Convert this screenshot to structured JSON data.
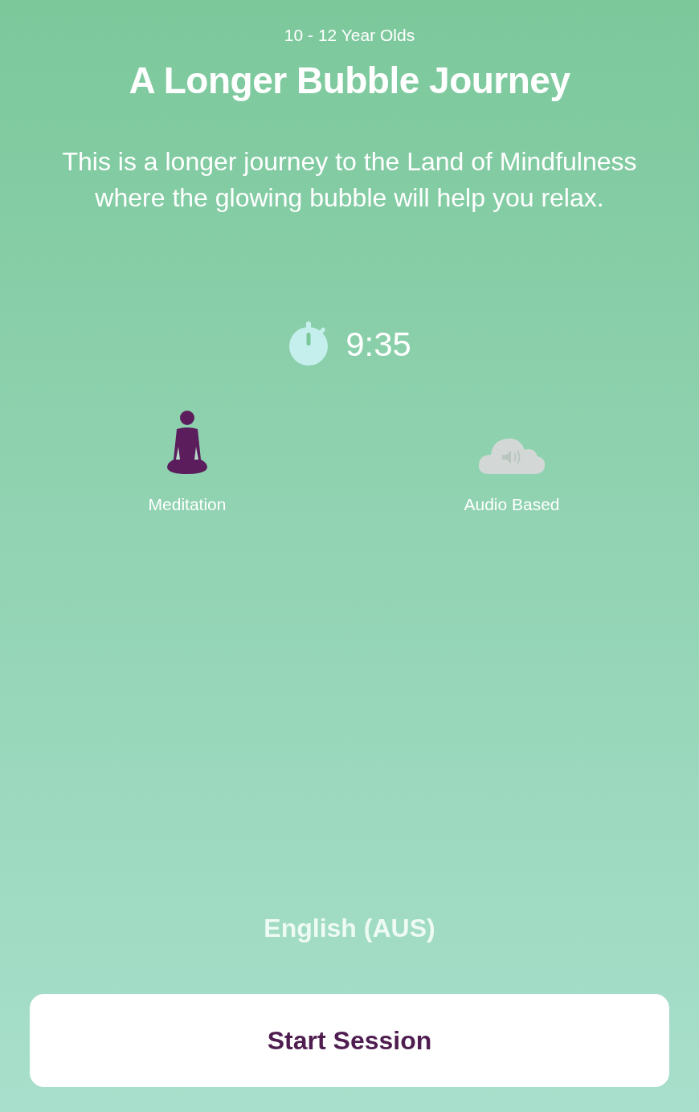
{
  "age_group": "10 - 12 Year Olds",
  "title": "A Longer Bubble Journey",
  "description": "This is a longer journey to the Land of Mindfulness where the glowing bubble will help you relax.",
  "duration": "9:35",
  "features": [
    {
      "kind": "meditation",
      "label": "Meditation",
      "active": true
    },
    {
      "kind": "audio",
      "label": "Audio Based",
      "active": false
    }
  ],
  "language": "English (AUS)",
  "start_button": "Start Session"
}
